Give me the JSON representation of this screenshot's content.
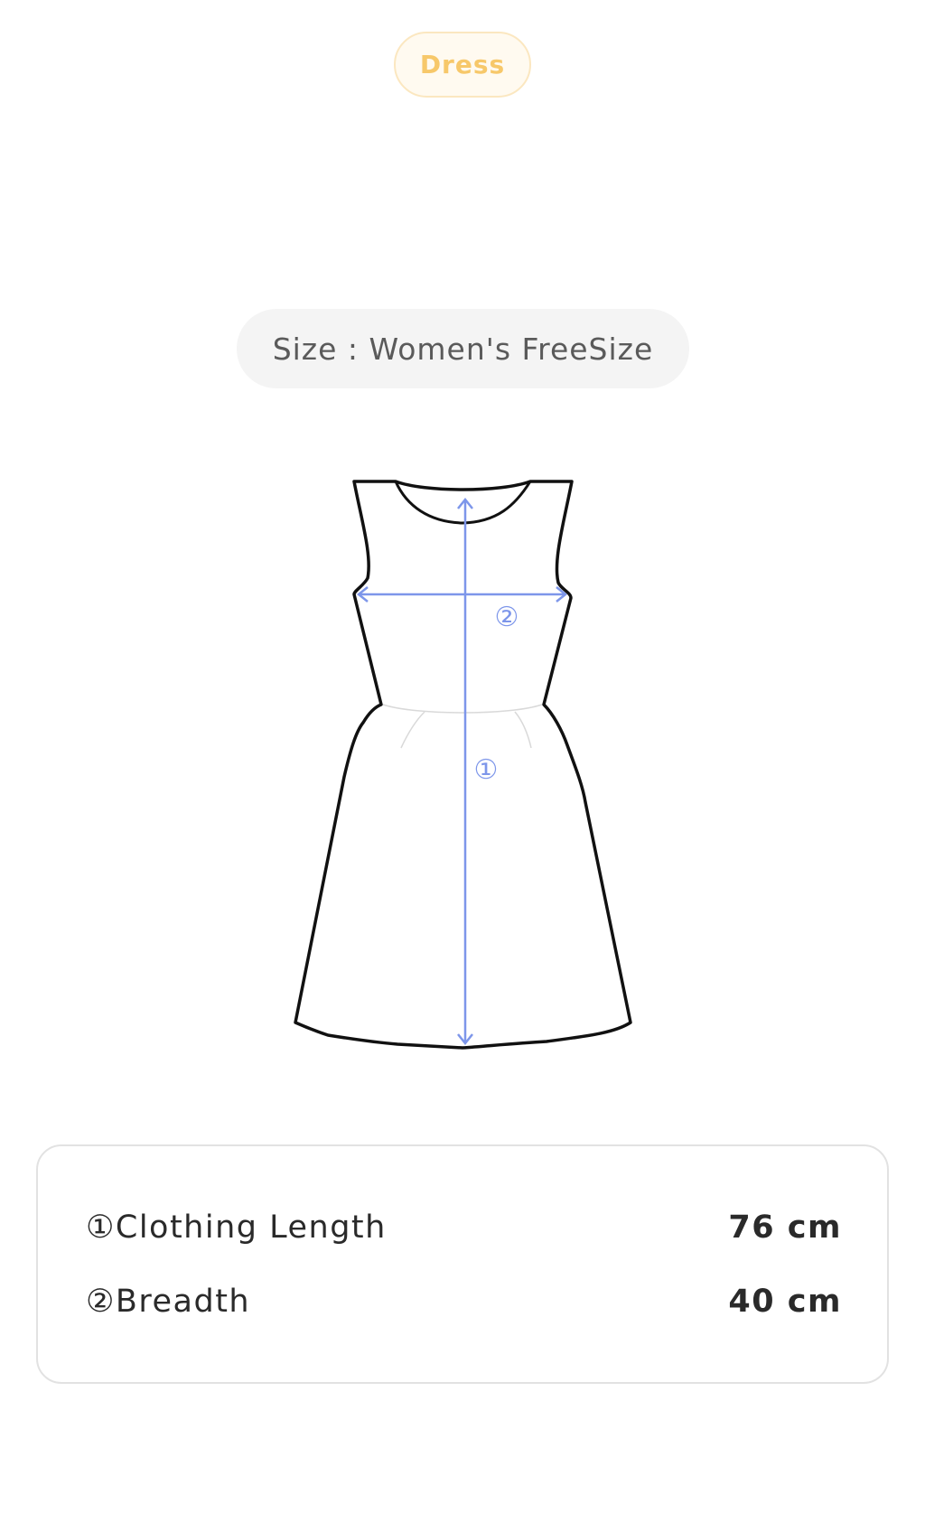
{
  "category": {
    "label": "Dress"
  },
  "size": {
    "label": "Size : Women's FreeSize"
  },
  "diagram": {
    "marker_length": "①",
    "marker_breadth": "②",
    "line_color": "#7d96ea",
    "outline_color": "#111111"
  },
  "measurements": [
    {
      "name": "①Clothing Length",
      "value": "76 cm"
    },
    {
      "name": "②Breadth",
      "value": "40 cm"
    }
  ],
  "colors": {
    "category_text": "#f7c86a",
    "category_border": "#fbe7c0",
    "pill_background": "#f4f4f4",
    "card_border": "#e2e2e2"
  }
}
